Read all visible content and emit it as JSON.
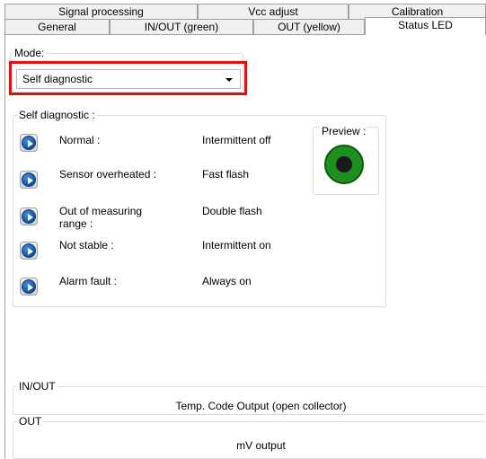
{
  "tabs": {
    "row1": [
      "Signal processing",
      "Vcc adjust",
      "Calibration"
    ],
    "row2": [
      "General",
      "IN/OUT (green)",
      "OUT (yellow)",
      "Status LED"
    ],
    "active": "Status LED"
  },
  "mode": {
    "label": "Mode:",
    "selected": "Self diagnostic"
  },
  "self_diagnostic": {
    "title": "Self diagnostic :",
    "rows": [
      {
        "label": "Normal :",
        "value": "Intermittent off"
      },
      {
        "label": "Sensor overheated :",
        "value": "Fast flash"
      },
      {
        "label": "Out of measuring range :",
        "value": "Double flash"
      },
      {
        "label": "Not stable :",
        "value": "Intermittent on"
      },
      {
        "label": "Alarm fault :",
        "value": "Always on"
      }
    ],
    "preview_label": "Preview :",
    "led_color": "#1f8f1f"
  },
  "in_out": {
    "title": "IN/OUT",
    "value": "Temp. Code Output (open collector)"
  },
  "out": {
    "title": "OUT",
    "value": "mV output"
  },
  "colors": {
    "highlight": "#e01010",
    "button_blue": "#0e4f9e"
  }
}
